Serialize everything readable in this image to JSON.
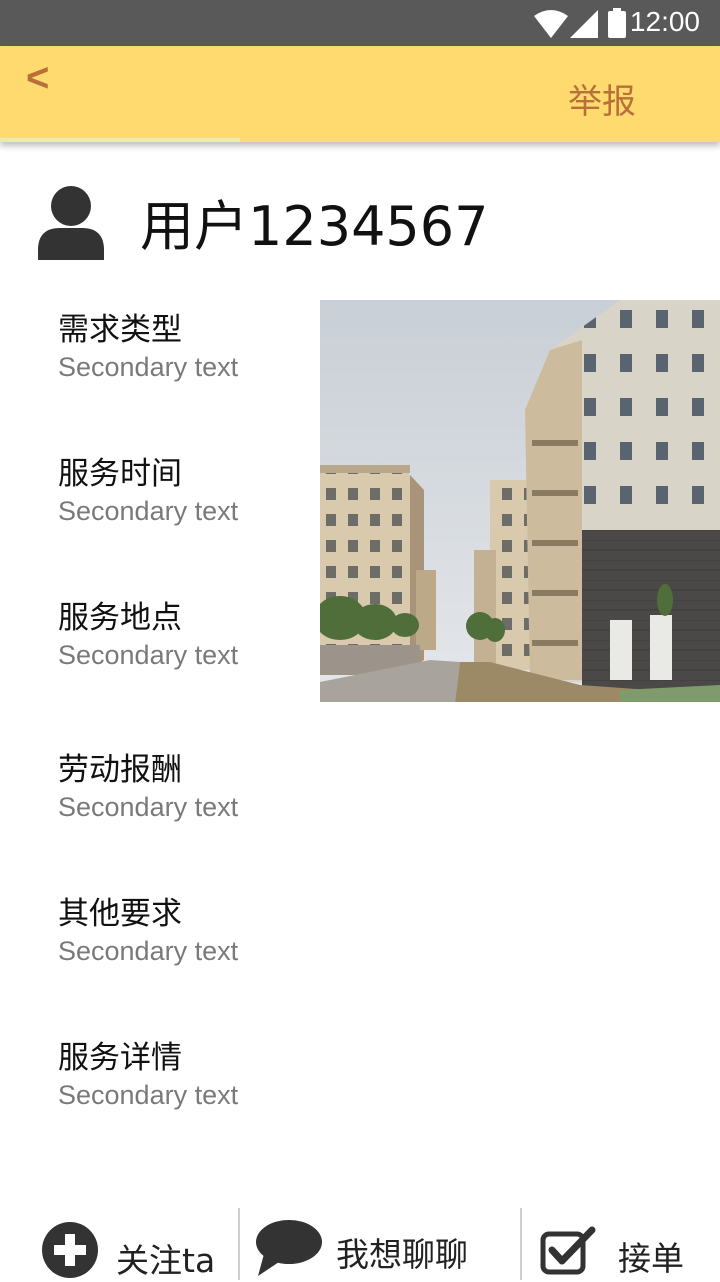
{
  "status_bar": {
    "time": "12:00",
    "icons": [
      "wifi-icon",
      "signal-icon",
      "battery-icon"
    ]
  },
  "top_bar": {
    "back_label": "<",
    "report_label": "举报",
    "background": "#FFDA6F",
    "accent": "#B8703A"
  },
  "user": {
    "avatar_icon": "person-icon",
    "name": "用户1234567"
  },
  "details": [
    {
      "label": "需求类型",
      "value": "Secondary text"
    },
    {
      "label": "服务时间",
      "value": "Secondary text"
    },
    {
      "label": "服务地点",
      "value": "Secondary text"
    },
    {
      "label": "劳动报酬",
      "value": "Secondary text"
    },
    {
      "label": "其他要求",
      "value": "Secondary text"
    },
    {
      "label": "服务详情",
      "value": "Secondary text"
    }
  ],
  "photo": {
    "subject": "apartment buildings"
  },
  "bottom_bar": {
    "follow": {
      "label": "关注ta",
      "icon": "plus-circle-icon"
    },
    "chat": {
      "label": "我想聊聊",
      "icon": "speech-bubble-icon"
    },
    "accept": {
      "label": "接单",
      "icon": "checkbox-icon"
    }
  }
}
